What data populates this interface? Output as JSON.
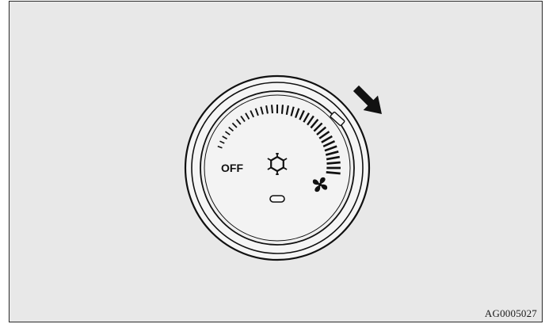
{
  "figure": {
    "caption": "AG0005027"
  },
  "dial": {
    "off_label": "OFF",
    "icons": [
      "snowflake-icon",
      "fan-icon"
    ],
    "scale_tick_count": 34,
    "colors": {
      "background": "#e8e8e8",
      "dial_face": "#f3f3f3",
      "ink": "#111111"
    }
  },
  "arrow": {
    "icon": "pointer-arrow-icon"
  }
}
